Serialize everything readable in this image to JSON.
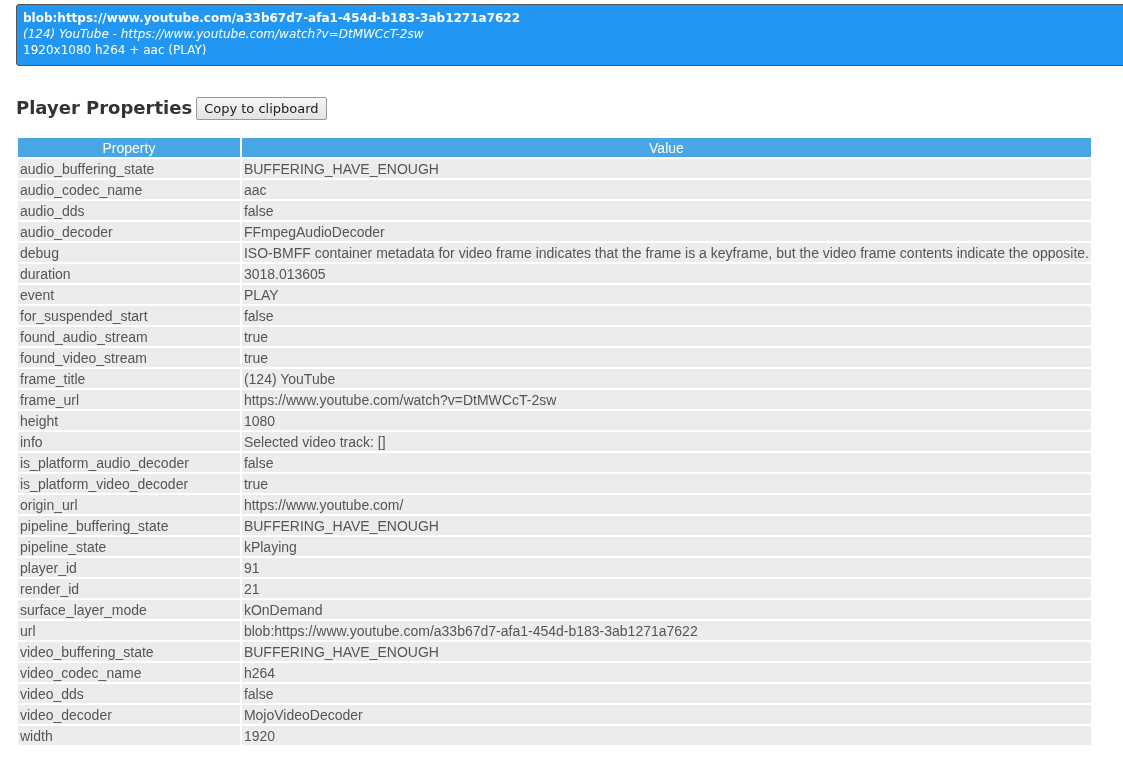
{
  "player": {
    "url": "blob:https://www.youtube.com/a33b67d7-afa1-454d-b183-3ab1271a7622",
    "title": "(124) YouTube - https://www.youtube.com/watch?v=DtMWCcT-2sw",
    "summary": "1920x1080 h264 + aac (PLAY)",
    "selected": true
  },
  "section": {
    "title": "Player Properties",
    "button": "Copy to clipboard"
  },
  "table": {
    "columns": [
      "Property",
      "Value"
    ],
    "rows": [
      [
        "audio_buffering_state",
        "BUFFERING_HAVE_ENOUGH"
      ],
      [
        "audio_codec_name",
        "aac"
      ],
      [
        "audio_dds",
        "false"
      ],
      [
        "audio_decoder",
        "FFmpegAudioDecoder"
      ],
      [
        "debug",
        "ISO-BMFF container metadata for video frame indicates that the frame is a keyframe, but the video frame contents indicate the opposite."
      ],
      [
        "duration",
        "3018.013605"
      ],
      [
        "event",
        "PLAY"
      ],
      [
        "for_suspended_start",
        "false"
      ],
      [
        "found_audio_stream",
        "true"
      ],
      [
        "found_video_stream",
        "true"
      ],
      [
        "frame_title",
        "(124) YouTube"
      ],
      [
        "frame_url",
        "https://www.youtube.com/watch?v=DtMWCcT-2sw"
      ],
      [
        "height",
        "1080"
      ],
      [
        "info",
        "Selected video track: []"
      ],
      [
        "is_platform_audio_decoder",
        "false"
      ],
      [
        "is_platform_video_decoder",
        "true"
      ],
      [
        "origin_url",
        "https://www.youtube.com/"
      ],
      [
        "pipeline_buffering_state",
        "BUFFERING_HAVE_ENOUGH"
      ],
      [
        "pipeline_state",
        "kPlaying"
      ],
      [
        "player_id",
        "91"
      ],
      [
        "render_id",
        "21"
      ],
      [
        "surface_layer_mode",
        "kOnDemand"
      ],
      [
        "url",
        "blob:https://www.youtube.com/a33b67d7-afa1-454d-b183-3ab1271a7622"
      ],
      [
        "video_buffering_state",
        "BUFFERING_HAVE_ENOUGH"
      ],
      [
        "video_codec_name",
        "h264"
      ],
      [
        "video_dds",
        "false"
      ],
      [
        "video_decoder",
        "MojoVideoDecoder"
      ],
      [
        "width",
        "1920"
      ]
    ]
  }
}
